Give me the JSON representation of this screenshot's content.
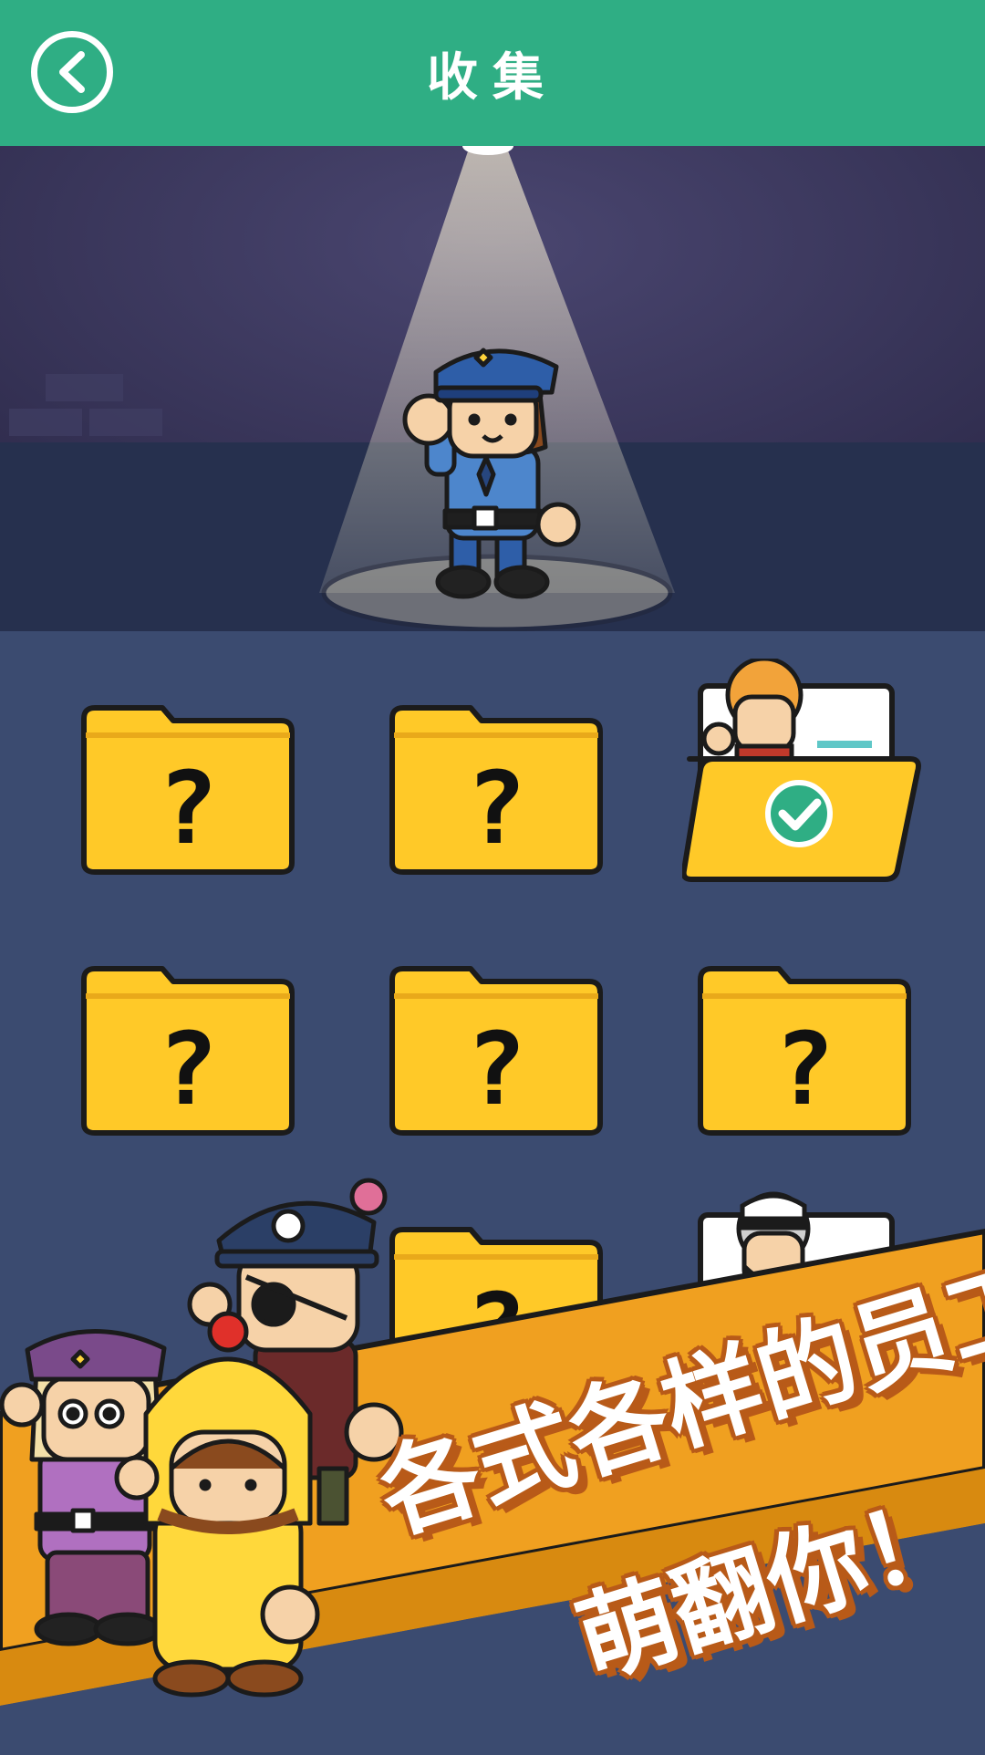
{
  "header": {
    "title": "收集",
    "back_icon": "chevron-left-icon",
    "background_color": "#2fae84"
  },
  "stage": {
    "spotlight_character": "police-officer"
  },
  "collection": {
    "items": [
      {
        "state": "locked",
        "label": "?"
      },
      {
        "state": "locked",
        "label": "?"
      },
      {
        "state": "unlocked",
        "character": "curly-haired-employee"
      },
      {
        "state": "locked",
        "label": "?"
      },
      {
        "state": "locked",
        "label": "?"
      },
      {
        "state": "locked",
        "label": "?"
      },
      {
        "state": "locked",
        "label": "?"
      },
      {
        "state": "unlocked",
        "character": "captain-employee"
      }
    ],
    "folder_color": "#ffc928",
    "check_color": "#2fae84"
  },
  "promo": {
    "line1": "各式各样的员工",
    "line2": "萌翻你！",
    "banner_color": "#f0a020"
  }
}
